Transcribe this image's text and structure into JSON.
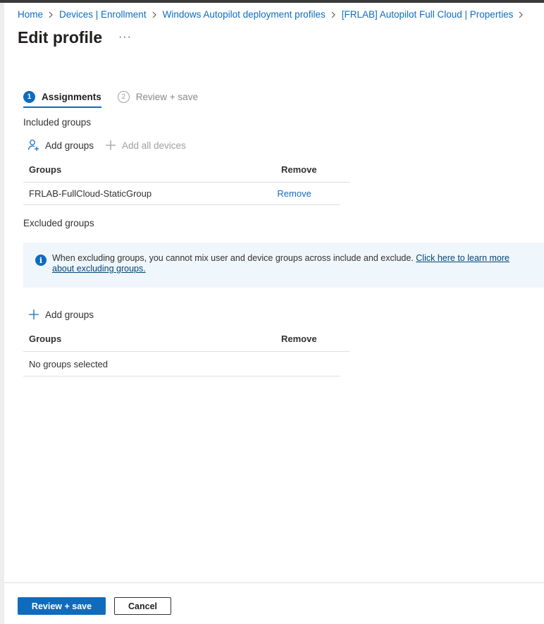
{
  "breadcrumb": [
    {
      "label": "Home"
    },
    {
      "label": "Devices | Enrollment"
    },
    {
      "label": "Windows Autopilot deployment profiles"
    },
    {
      "label": "[FRLAB] Autopilot Full Cloud | Properties"
    }
  ],
  "page": {
    "title": "Edit profile",
    "more_label": "···"
  },
  "steps": [
    {
      "number": "1",
      "label": "Assignments",
      "active": true
    },
    {
      "number": "2",
      "label": "Review + save",
      "active": false
    }
  ],
  "included": {
    "label": "Included groups",
    "add_groups_label": "Add groups",
    "add_all_devices_label": "Add all devices",
    "columns": [
      "Groups",
      "Remove"
    ],
    "rows": [
      {
        "group": "FRLAB-FullCloud-StaticGroup",
        "remove": "Remove"
      }
    ]
  },
  "excluded": {
    "label": "Excluded groups",
    "info_text": "When excluding groups, you cannot mix user and device groups across include and exclude. ",
    "info_link": "Click here to learn more about excluding groups.",
    "add_groups_label": "Add groups",
    "columns": [
      "Groups",
      "Remove"
    ],
    "empty_text": "No groups selected"
  },
  "footer": {
    "primary_label": "Review + save",
    "secondary_label": "Cancel"
  },
  "colors": {
    "accent": "#0f6cbd",
    "info_background": "#eff6fc"
  },
  "icons": {
    "add_groups": "person-add-icon",
    "add_all": "plus-icon",
    "info": "info-icon",
    "separator": "chevron-right-icon"
  }
}
